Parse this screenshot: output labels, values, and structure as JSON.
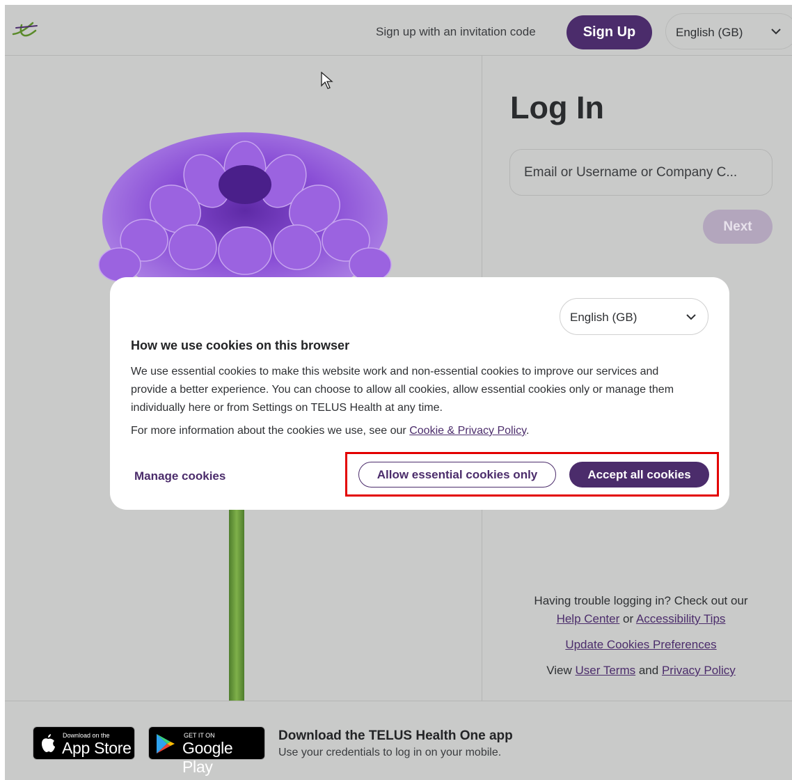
{
  "header": {
    "invite_text": "Sign up with an invitation code",
    "signup_label": "Sign Up",
    "language": "English (GB)"
  },
  "login": {
    "title": "Log In",
    "email_placeholder": "Email or Username or Company C...",
    "next_label": "Next"
  },
  "help": {
    "trouble_text": "Having trouble logging in? Check out our",
    "help_center": "Help Center",
    "or": "or",
    "accessibility": "Accessibility Tips",
    "update_cookies": "Update Cookies Preferences",
    "view": "View",
    "user_terms": "User Terms",
    "and": "and",
    "privacy_policy": "Privacy Policy"
  },
  "footer": {
    "appstore_small": "Download on the",
    "appstore_big": "App Store",
    "googleplay_small": "GET IT ON",
    "googleplay_big": "Google Play",
    "app_title": "Download the TELUS Health One app",
    "app_subtitle": "Use your credentials to log in on your mobile."
  },
  "cookie_modal": {
    "language": "English (GB)",
    "title": "How we use cookies on this browser",
    "body": "We use essential cookies to make this website work and non-essential cookies to improve our services and provide a better experience. You can choose to allow all cookies, allow essential cookies only or manage them individually here or from Settings on TELUS Health at any time.",
    "more_info": "For more information about the cookies we use, see our",
    "policy_link": "Cookie & Privacy Policy",
    "period": ".",
    "manage_label": "Manage cookies",
    "essential_label": "Allow essential cookies only",
    "accept_label": "Accept all cookies"
  },
  "colors": {
    "brand_purple": "#4b2c6b",
    "backdrop": "#c9cac9",
    "highlight": "#e30000"
  },
  "icons": [
    "telus-logo-icon",
    "chevron-down-icon",
    "cursor-icon",
    "apple-icon",
    "google-play-icon"
  ]
}
